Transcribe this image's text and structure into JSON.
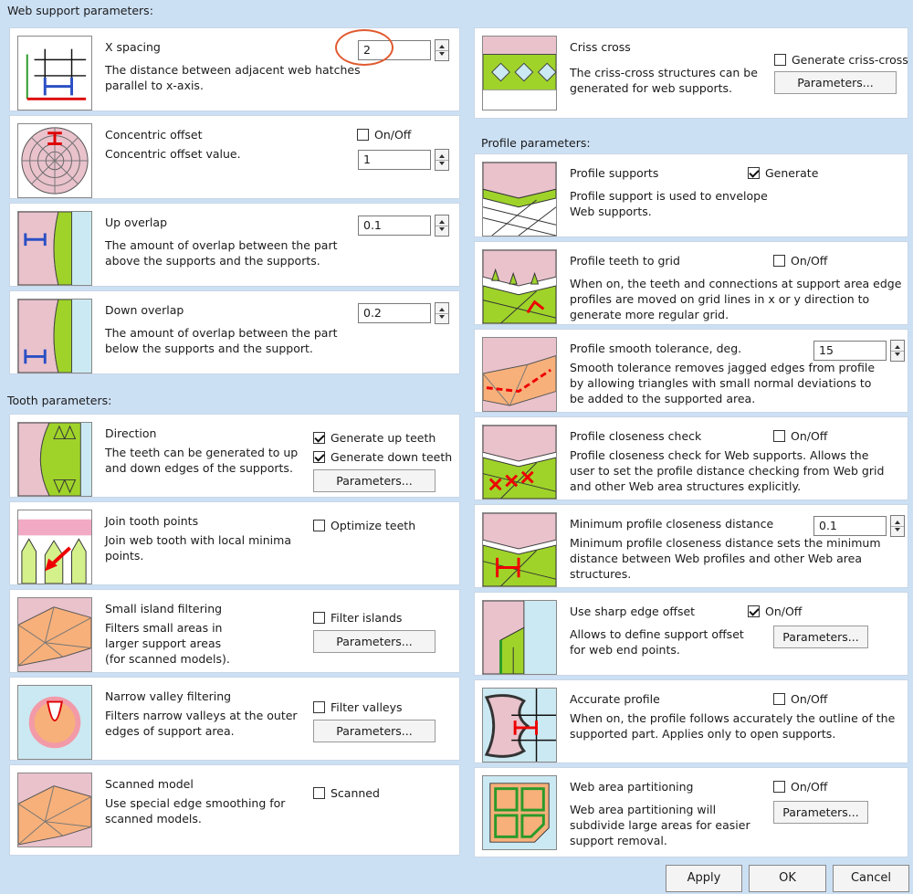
{
  "web_header": "Web support parameters:",
  "tooth_header": "Tooth parameters:",
  "profile_header": "Profile parameters:",
  "x_spacing": {
    "title": "X spacing",
    "desc": "The distance between adjacent web hatches\nparallel to x-axis.",
    "value": "2"
  },
  "concentric": {
    "title": "Concentric offset",
    "desc": "Concentric offset value.",
    "checkbox": "On/Off",
    "checked": false,
    "value": "1"
  },
  "up_overlap": {
    "title": "Up overlap",
    "desc": "The amount of overlap between the part\nabove the supports and the supports.",
    "value": "0.1"
  },
  "down_overlap": {
    "title": "Down overlap",
    "desc": "The amount of overlap between the part\nbelow the supports and the support.",
    "value": "0.2"
  },
  "direction": {
    "title": "Direction",
    "desc": "The teeth can be generated to up\nand down edges of the supports.",
    "cb1": "Generate up teeth",
    "cb2": "Generate down teeth",
    "button": "Parameters..."
  },
  "join_tooth": {
    "title": "Join tooth points",
    "desc": "Join web tooth with local minima\npoints.",
    "checkbox": "Optimize teeth"
  },
  "small_island": {
    "title": "Small island filtering",
    "desc": "Filters small areas in\nlarger support areas\n(for scanned models).",
    "checkbox": "Filter islands",
    "button": "Parameters..."
  },
  "narrow_valley": {
    "title": "Narrow valley filtering",
    "desc": "Filters narrow valleys at the outer\nedges of support area.",
    "checkbox": "Filter valleys",
    "button": "Parameters..."
  },
  "scanned_model": {
    "title": "Scanned model",
    "desc": "Use special edge smoothing for\nscanned models.",
    "checkbox": "Scanned"
  },
  "criss_cross": {
    "title": "Criss cross",
    "desc": "The criss-cross structures can be\ngenerated for web supports.",
    "checkbox": "Generate criss-cross",
    "button": "Parameters..."
  },
  "profile_supports": {
    "title": "Profile supports",
    "desc": "Profile support is used to envelope\nWeb supports.",
    "checkbox": "Generate"
  },
  "profile_teeth": {
    "title": "Profile teeth to grid",
    "desc": "When on, the teeth and connections at support area edge\nprofiles are moved on grid lines in x or y direction to\ngenerate more regular grid.",
    "checkbox": "On/Off"
  },
  "smooth_tol": {
    "title": "Profile smooth tolerance, deg.",
    "desc": "Smooth tolerance removes jagged edges from profile\nby allowing triangles with small normal deviations to\nbe added to the supported area.",
    "value": "15"
  },
  "closeness_check": {
    "title": "Profile closeness check",
    "desc": "Profile closeness check for Web supports. Allows the\nuser to set the profile distance checking from Web grid\nand other Web area structures explicitly.",
    "checkbox": "On/Off"
  },
  "min_closeness": {
    "title": "Minimum profile closeness distance",
    "desc": "Minimum profile closeness distance sets the minimum\ndistance between Web profiles and other Web area\nstructures.",
    "value": "0.1"
  },
  "sharp_edge": {
    "title": "Use sharp edge offset",
    "desc": "Allows to define support offset\nfor web end points.",
    "checkbox": "On/Off",
    "button": "Parameters..."
  },
  "accurate_profile": {
    "title": "Accurate profile",
    "desc": "When on, the profile follows accurately the outline of the\nsupported part. Applies only to open supports.",
    "checkbox": "On/Off"
  },
  "partitioning": {
    "title": "Web area partitioning",
    "desc": "Web area partitioning will\nsubdivide large areas for easier\nsupport removal.",
    "checkbox": "On/Off",
    "button": "Parameters..."
  },
  "footer": {
    "apply": "Apply",
    "ok": "OK",
    "cancel": "Cancel"
  }
}
